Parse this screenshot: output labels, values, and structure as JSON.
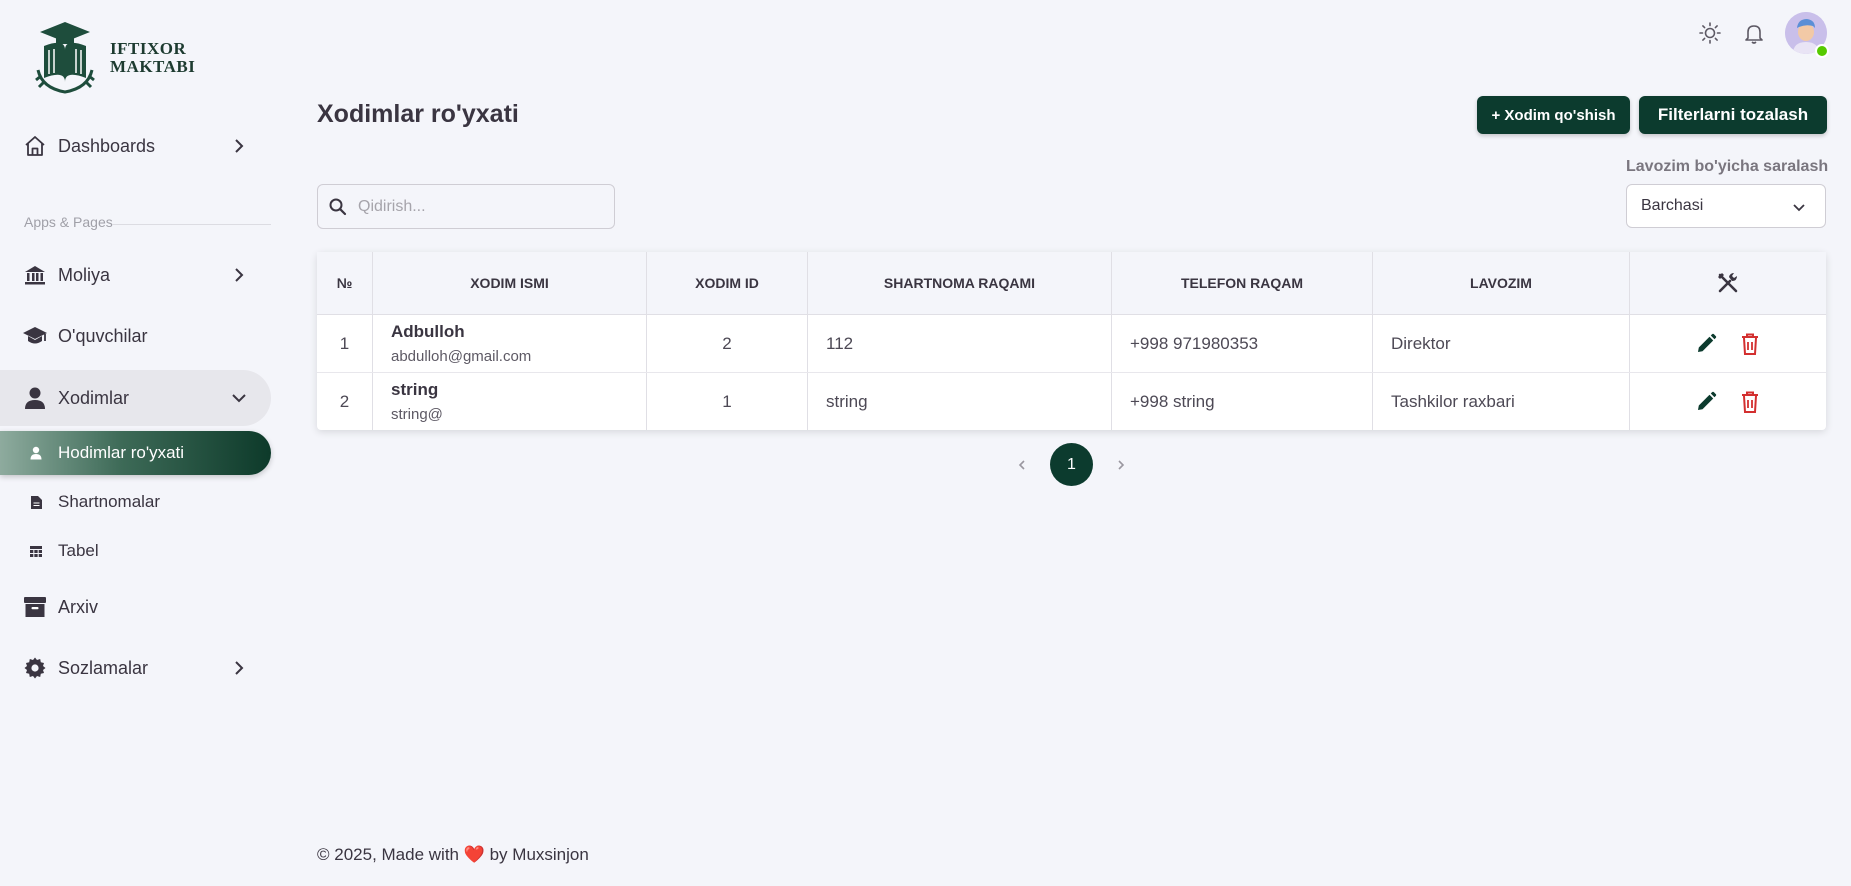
{
  "brand": {
    "line1": "IFTIXOR",
    "line2": "MAKTABI"
  },
  "sidebar": {
    "section_label": "Apps & Pages",
    "items": [
      {
        "label": "Dashboards",
        "icon": "home-icon"
      },
      {
        "label": "Moliya",
        "icon": "bank-icon"
      },
      {
        "label": "O'quvchilar",
        "icon": "graduation-cap-icon"
      },
      {
        "label": "Xodimlar",
        "icon": "person-icon"
      },
      {
        "label": "Arxiv",
        "icon": "archive-icon"
      },
      {
        "label": "Sozlamalar",
        "icon": "gear-icon"
      }
    ],
    "sub_items": [
      {
        "label": "Hodimlar ro'yxati",
        "icon": "person-small-icon"
      },
      {
        "label": "Shartnomalar",
        "icon": "document-icon"
      },
      {
        "label": "Tabel",
        "icon": "table-icon"
      }
    ]
  },
  "topbar": {
    "icons": [
      "sun-icon",
      "bell-icon",
      "avatar"
    ]
  },
  "page": {
    "title": "Xodimlar ro'yxati",
    "add_button": "+ Xodim qo'shish",
    "clear_button": "Filterlarni tozalash",
    "search_placeholder": "Qidirish...",
    "filter_label": "Lavozim bo'yicha saralash",
    "filter_value": "Barchasi"
  },
  "table": {
    "headers": [
      "№",
      "XODIM ISMI",
      "XODIM ID",
      "SHARTNOMA RAQAMI",
      "TELEFON RAQAM",
      "LAVOZIM"
    ],
    "rows": [
      {
        "n": "1",
        "name": "Adbulloh",
        "email": "abdulloh@gmail.com",
        "id": "2",
        "contract": "112",
        "phone": "+998 971980353",
        "position": "Direktor"
      },
      {
        "n": "2",
        "name": "string",
        "email": "string@",
        "id": "1",
        "contract": "string",
        "phone": "+998 string",
        "position": "Tashkilor raxbari"
      }
    ]
  },
  "pagination": {
    "current": "1"
  },
  "footer": {
    "text": "© 2025, Made with ❤️ by Muxsinjon"
  },
  "colors": {
    "brand_dark": "#0c3b2e",
    "delete_red": "#d32f2f",
    "online": "#56ca00"
  }
}
